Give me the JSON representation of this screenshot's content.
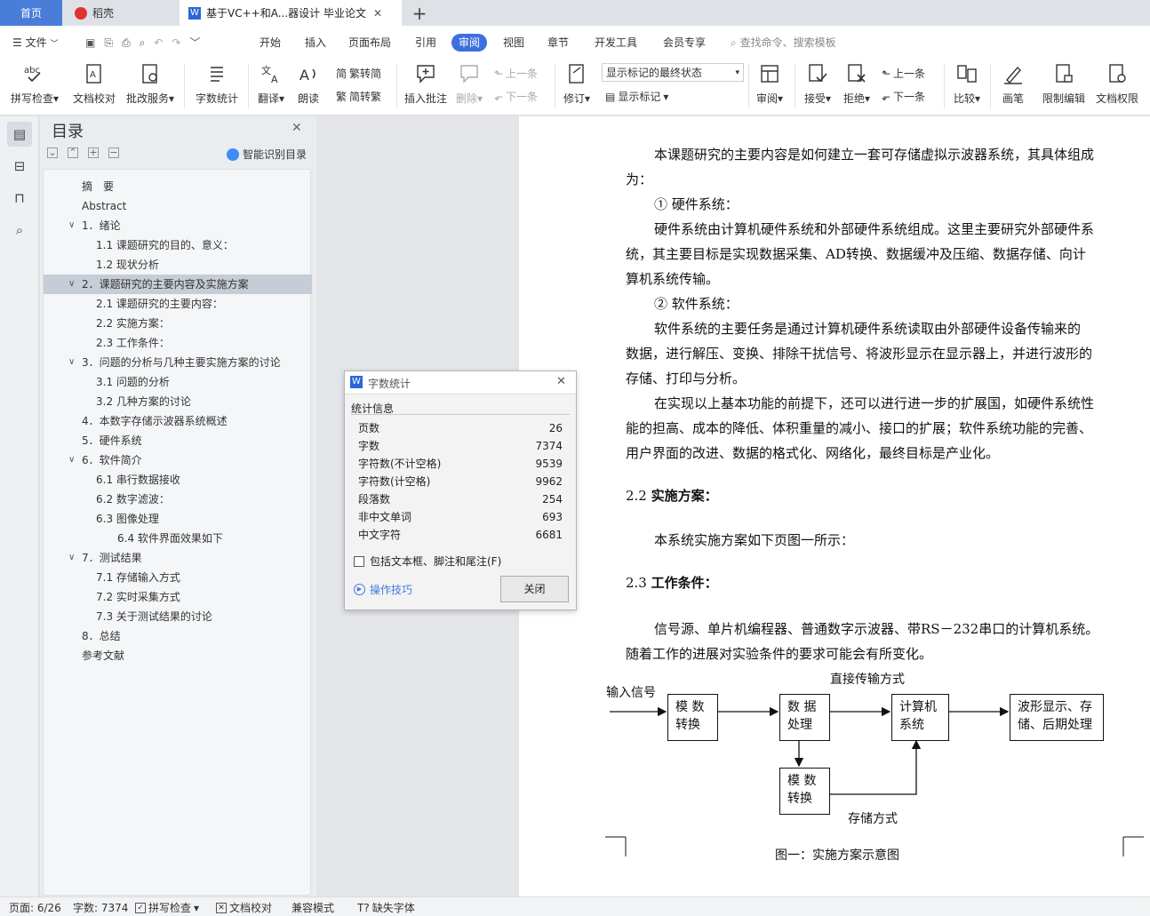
{
  "tabs": {
    "home": "首页",
    "daoke": "稻壳",
    "doc": "基于VC++和A...器设计 毕业论文"
  },
  "menu": {
    "file": "文件",
    "items": [
      "开始",
      "插入",
      "页面布局",
      "引用",
      "审阅",
      "视图",
      "章节",
      "开发工具",
      "会员专享"
    ],
    "search_placeholder": "查找命令、搜索模板"
  },
  "ribbon": {
    "spell_check": "拼写检查",
    "doc_proof": "文档校对",
    "batch_service": "批改服务",
    "word_count": "字数统计",
    "translate": "翻译",
    "read_aloud": "朗读",
    "to_traditional": "繁转简",
    "to_simplified": "简转繁",
    "insert_comment": "插入批注",
    "delete": "删除",
    "prev_comment": "上一条",
    "next_comment": "下一条",
    "revise": "修订",
    "markup_dropdown": "显示标记的最终状态",
    "show_markup": "显示标记",
    "review": "审阅",
    "accept": "接受",
    "reject": "拒绝",
    "prev_change": "上一条",
    "next_change": "下一条",
    "compare": "比较",
    "pen": "画笔",
    "restrict_edit": "限制编辑",
    "doc_permission": "文档权限"
  },
  "toc": {
    "title": "目录",
    "smart_toc": "智能识别目录",
    "items": [
      {
        "label": "摘　要",
        "level": 1,
        "caret": ""
      },
      {
        "label": "Abstract",
        "level": 1,
        "caret": ""
      },
      {
        "label": "1．绪论",
        "level": 1,
        "caret": "v"
      },
      {
        "label": "1.1 课题研究的目的、意义：",
        "level": 2,
        "caret": ""
      },
      {
        "label": "1.2 现状分析",
        "level": 2,
        "caret": ""
      },
      {
        "label": "2．课题研究的主要内容及实施方案",
        "level": 1,
        "caret": "v",
        "selected": true
      },
      {
        "label": "2.1 课题研究的主要内容：",
        "level": 2,
        "caret": ""
      },
      {
        "label": "2.2 实施方案：",
        "level": 2,
        "caret": ""
      },
      {
        "label": "2.3 工作条件：",
        "level": 2,
        "caret": ""
      },
      {
        "label": "3．问题的分析与几种主要实施方案的讨论",
        "level": 1,
        "caret": "v"
      },
      {
        "label": "3.1 问题的分析",
        "level": 2,
        "caret": ""
      },
      {
        "label": "3.2 几种方案的讨论",
        "level": 2,
        "caret": ""
      },
      {
        "label": "4．本数字存储示波器系统概述",
        "level": 1,
        "caret": ""
      },
      {
        "label": "5．硬件系统",
        "level": 1,
        "caret": ""
      },
      {
        "label": "6．软件简介",
        "level": 1,
        "caret": "v"
      },
      {
        "label": "6.1 串行数据接收",
        "level": 2,
        "caret": ""
      },
      {
        "label": "6.2 数字滤波：",
        "level": 2,
        "caret": ""
      },
      {
        "label": "6.3 图像处理",
        "level": 2,
        "caret": ""
      },
      {
        "label": "6.4 软件界面效果如下",
        "level": 3,
        "caret": ""
      },
      {
        "label": "7．测试结果",
        "level": 1,
        "caret": "v"
      },
      {
        "label": "7.1 存储输入方式",
        "level": 2,
        "caret": ""
      },
      {
        "label": "7.2 实时采集方式",
        "level": 2,
        "caret": ""
      },
      {
        "label": "7.3 关于测试结果的讨论",
        "level": 2,
        "caret": ""
      },
      {
        "label": "8．总结",
        "level": 1,
        "caret": ""
      },
      {
        "label": "参考文献",
        "level": 1,
        "caret": ""
      }
    ]
  },
  "document": {
    "lines": [
      "本课题研究的主要内容是如何建立一套可存储虚拟示波器系统，其具体组成",
      "为：",
      "①  硬件系统：",
      "硬件系统由计算机硬件系统和外部硬件系统组成。这里主要研究外部硬件系",
      "统，其主要目标是实现数据采集、AD转换、数据缓冲及压缩、数据存储、向计",
      "算机系统传输。",
      "②  软件系统：",
      "软件系统的主要任务是通过计算机硬件系统读取由外部硬件设备传输来的",
      "数据，进行解压、变换、排除干扰信号、将波形显示在显示器上，并进行波形的",
      "存储、打印与分析。",
      "在实现以上基本功能的前提下，还可以进行进一步的扩展国，如硬件系统性",
      "能的担高、成本的降低、体积重量的减小、接口的扩展；软件系统功能的完善、",
      "用户界面的改进、数据的格式化、网络化，最终目标是产业化。",
      "本系统实施方案如下页图一所示：",
      "信号源、单片机编程器、普通数字示波器、带RS－232串口的计算机系统。",
      "随着工作的进展对实验条件的要求可能会有所变化。"
    ],
    "heading_22_num": "2.2",
    "heading_22_text": "实施方案：",
    "heading_23_num": "2.3",
    "heading_23_text": "工作条件：",
    "diagram": {
      "input_label": "输入信号",
      "direct_label": "直接传输方式",
      "storage_label": "存储方式",
      "box_ad1": "模 数\n转换",
      "box_proc": "数 据\n处理",
      "box_pc": "计算机\n系统",
      "box_out": "波形显示、存\n储、后期处理",
      "box_ad2": "模 数\n转换",
      "caption": "图一：实施方案示意图"
    }
  },
  "dialog": {
    "title": "字数统计",
    "section": "统计信息",
    "stats": [
      {
        "label": "页数",
        "value": "26"
      },
      {
        "label": "字数",
        "value": "7374"
      },
      {
        "label": "字符数(不计空格)",
        "value": "9539"
      },
      {
        "label": "字符数(计空格)",
        "value": "9962"
      },
      {
        "label": "段落数",
        "value": "254"
      },
      {
        "label": "非中文单词",
        "value": "693"
      },
      {
        "label": "中文字符",
        "value": "6681"
      }
    ],
    "checkbox_label": "包括文本框、脚注和尾注(F)",
    "tips_link": "操作技巧",
    "close_button": "关闭"
  },
  "status": {
    "page": "页面: 6/26",
    "words": "字数: 7374",
    "spell": "拼写检查",
    "proof": "文档校对",
    "compat": "兼容模式",
    "missing_font": "缺失字体"
  },
  "colors": {
    "accent": "#3e6fe0",
    "tab_home": "#4a7dd9",
    "toc_selected": "#c6cdd6"
  }
}
